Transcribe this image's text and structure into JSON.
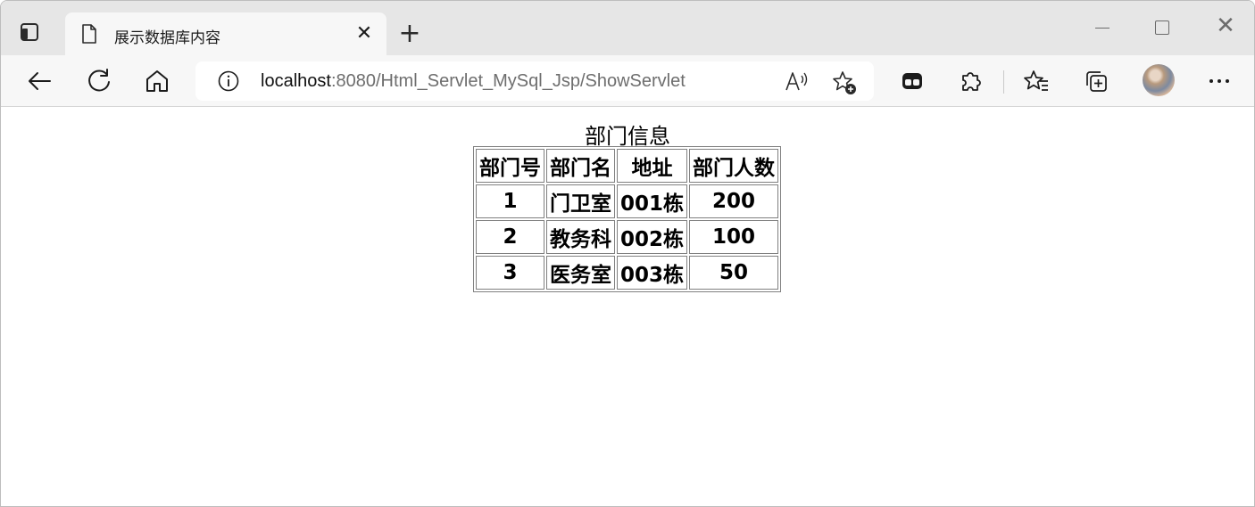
{
  "browser": {
    "tab_title": "展示数据库内容",
    "url_host": "localhost",
    "url_rest": ":8080/Html_Servlet_MySql_Jsp/ShowServlet",
    "new_tab_glyph": "+",
    "close_glyph": "✕",
    "toolbar_icons": [
      "back-icon",
      "refresh-icon",
      "home-icon",
      "read-aloud-icon",
      "add-favorite-icon",
      "extension-app-icon",
      "extensions-icon",
      "favorites-icon",
      "collections-icon",
      "profile-avatar",
      "more-icon"
    ]
  },
  "page": {
    "caption": "部门信息",
    "headers": [
      "部门号",
      "部门名",
      "地址",
      "部门人数"
    ],
    "rows": [
      [
        "1",
        "门卫室",
        "001栋",
        "200"
      ],
      [
        "2",
        "教务科",
        "002栋",
        "100"
      ],
      [
        "3",
        "医务室",
        "003栋",
        "50"
      ]
    ]
  }
}
